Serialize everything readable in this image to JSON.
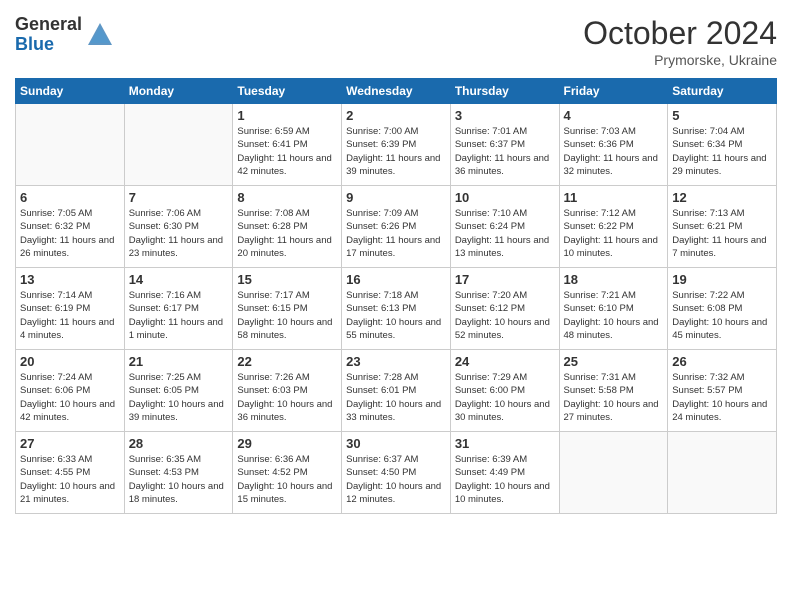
{
  "logo": {
    "general": "General",
    "blue": "Blue"
  },
  "header": {
    "month": "October 2024",
    "location": "Prymorske, Ukraine"
  },
  "weekdays": [
    "Sunday",
    "Monday",
    "Tuesday",
    "Wednesday",
    "Thursday",
    "Friday",
    "Saturday"
  ],
  "weeks": [
    [
      {
        "day": "",
        "sunrise": "",
        "sunset": "",
        "daylight": ""
      },
      {
        "day": "",
        "sunrise": "",
        "sunset": "",
        "daylight": ""
      },
      {
        "day": "1",
        "sunrise": "Sunrise: 6:59 AM",
        "sunset": "Sunset: 6:41 PM",
        "daylight": "Daylight: 11 hours and 42 minutes."
      },
      {
        "day": "2",
        "sunrise": "Sunrise: 7:00 AM",
        "sunset": "Sunset: 6:39 PM",
        "daylight": "Daylight: 11 hours and 39 minutes."
      },
      {
        "day": "3",
        "sunrise": "Sunrise: 7:01 AM",
        "sunset": "Sunset: 6:37 PM",
        "daylight": "Daylight: 11 hours and 36 minutes."
      },
      {
        "day": "4",
        "sunrise": "Sunrise: 7:03 AM",
        "sunset": "Sunset: 6:36 PM",
        "daylight": "Daylight: 11 hours and 32 minutes."
      },
      {
        "day": "5",
        "sunrise": "Sunrise: 7:04 AM",
        "sunset": "Sunset: 6:34 PM",
        "daylight": "Daylight: 11 hours and 29 minutes."
      }
    ],
    [
      {
        "day": "6",
        "sunrise": "Sunrise: 7:05 AM",
        "sunset": "Sunset: 6:32 PM",
        "daylight": "Daylight: 11 hours and 26 minutes."
      },
      {
        "day": "7",
        "sunrise": "Sunrise: 7:06 AM",
        "sunset": "Sunset: 6:30 PM",
        "daylight": "Daylight: 11 hours and 23 minutes."
      },
      {
        "day": "8",
        "sunrise": "Sunrise: 7:08 AM",
        "sunset": "Sunset: 6:28 PM",
        "daylight": "Daylight: 11 hours and 20 minutes."
      },
      {
        "day": "9",
        "sunrise": "Sunrise: 7:09 AM",
        "sunset": "Sunset: 6:26 PM",
        "daylight": "Daylight: 11 hours and 17 minutes."
      },
      {
        "day": "10",
        "sunrise": "Sunrise: 7:10 AM",
        "sunset": "Sunset: 6:24 PM",
        "daylight": "Daylight: 11 hours and 13 minutes."
      },
      {
        "day": "11",
        "sunrise": "Sunrise: 7:12 AM",
        "sunset": "Sunset: 6:22 PM",
        "daylight": "Daylight: 11 hours and 10 minutes."
      },
      {
        "day": "12",
        "sunrise": "Sunrise: 7:13 AM",
        "sunset": "Sunset: 6:21 PM",
        "daylight": "Daylight: 11 hours and 7 minutes."
      }
    ],
    [
      {
        "day": "13",
        "sunrise": "Sunrise: 7:14 AM",
        "sunset": "Sunset: 6:19 PM",
        "daylight": "Daylight: 11 hours and 4 minutes."
      },
      {
        "day": "14",
        "sunrise": "Sunrise: 7:16 AM",
        "sunset": "Sunset: 6:17 PM",
        "daylight": "Daylight: 11 hours and 1 minute."
      },
      {
        "day": "15",
        "sunrise": "Sunrise: 7:17 AM",
        "sunset": "Sunset: 6:15 PM",
        "daylight": "Daylight: 10 hours and 58 minutes."
      },
      {
        "day": "16",
        "sunrise": "Sunrise: 7:18 AM",
        "sunset": "Sunset: 6:13 PM",
        "daylight": "Daylight: 10 hours and 55 minutes."
      },
      {
        "day": "17",
        "sunrise": "Sunrise: 7:20 AM",
        "sunset": "Sunset: 6:12 PM",
        "daylight": "Daylight: 10 hours and 52 minutes."
      },
      {
        "day": "18",
        "sunrise": "Sunrise: 7:21 AM",
        "sunset": "Sunset: 6:10 PM",
        "daylight": "Daylight: 10 hours and 48 minutes."
      },
      {
        "day": "19",
        "sunrise": "Sunrise: 7:22 AM",
        "sunset": "Sunset: 6:08 PM",
        "daylight": "Daylight: 10 hours and 45 minutes."
      }
    ],
    [
      {
        "day": "20",
        "sunrise": "Sunrise: 7:24 AM",
        "sunset": "Sunset: 6:06 PM",
        "daylight": "Daylight: 10 hours and 42 minutes."
      },
      {
        "day": "21",
        "sunrise": "Sunrise: 7:25 AM",
        "sunset": "Sunset: 6:05 PM",
        "daylight": "Daylight: 10 hours and 39 minutes."
      },
      {
        "day": "22",
        "sunrise": "Sunrise: 7:26 AM",
        "sunset": "Sunset: 6:03 PM",
        "daylight": "Daylight: 10 hours and 36 minutes."
      },
      {
        "day": "23",
        "sunrise": "Sunrise: 7:28 AM",
        "sunset": "Sunset: 6:01 PM",
        "daylight": "Daylight: 10 hours and 33 minutes."
      },
      {
        "day": "24",
        "sunrise": "Sunrise: 7:29 AM",
        "sunset": "Sunset: 6:00 PM",
        "daylight": "Daylight: 10 hours and 30 minutes."
      },
      {
        "day": "25",
        "sunrise": "Sunrise: 7:31 AM",
        "sunset": "Sunset: 5:58 PM",
        "daylight": "Daylight: 10 hours and 27 minutes."
      },
      {
        "day": "26",
        "sunrise": "Sunrise: 7:32 AM",
        "sunset": "Sunset: 5:57 PM",
        "daylight": "Daylight: 10 hours and 24 minutes."
      }
    ],
    [
      {
        "day": "27",
        "sunrise": "Sunrise: 6:33 AM",
        "sunset": "Sunset: 4:55 PM",
        "daylight": "Daylight: 10 hours and 21 minutes."
      },
      {
        "day": "28",
        "sunrise": "Sunrise: 6:35 AM",
        "sunset": "Sunset: 4:53 PM",
        "daylight": "Daylight: 10 hours and 18 minutes."
      },
      {
        "day": "29",
        "sunrise": "Sunrise: 6:36 AM",
        "sunset": "Sunset: 4:52 PM",
        "daylight": "Daylight: 10 hours and 15 minutes."
      },
      {
        "day": "30",
        "sunrise": "Sunrise: 6:37 AM",
        "sunset": "Sunset: 4:50 PM",
        "daylight": "Daylight: 10 hours and 12 minutes."
      },
      {
        "day": "31",
        "sunrise": "Sunrise: 6:39 AM",
        "sunset": "Sunset: 4:49 PM",
        "daylight": "Daylight: 10 hours and 10 minutes."
      },
      {
        "day": "",
        "sunrise": "",
        "sunset": "",
        "daylight": ""
      },
      {
        "day": "",
        "sunrise": "",
        "sunset": "",
        "daylight": ""
      }
    ]
  ]
}
